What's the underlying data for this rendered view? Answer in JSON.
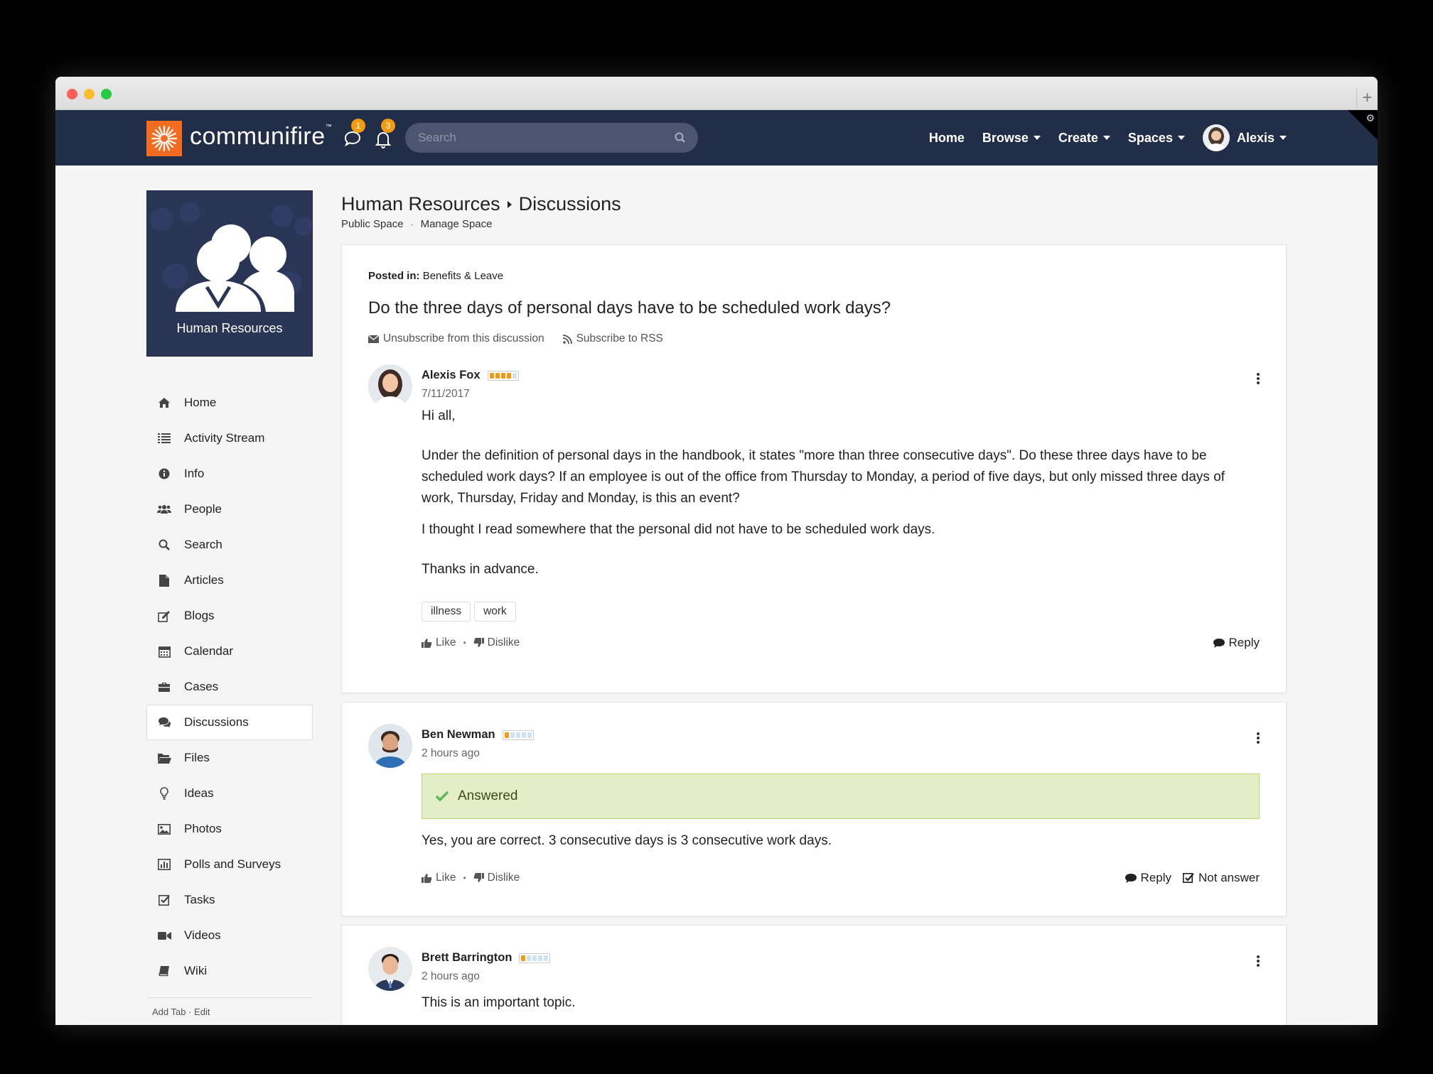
{
  "browser": {
    "new_tab": "+"
  },
  "nav": {
    "logo_text": "communifire",
    "logo_tm": "™",
    "messages_badge": "1",
    "notifications_badge": "3",
    "search_placeholder": "Search",
    "links": {
      "home": "Home",
      "browse": "Browse",
      "create": "Create",
      "spaces": "Spaces"
    },
    "user_name": "Alexis"
  },
  "sidebar": {
    "space_name": "Human Resources",
    "items": [
      {
        "label": "Home",
        "icon": "home-icon"
      },
      {
        "label": "Activity Stream",
        "icon": "list-icon"
      },
      {
        "label": "Info",
        "icon": "info-icon"
      },
      {
        "label": "People",
        "icon": "people-icon"
      },
      {
        "label": "Search",
        "icon": "search-icon"
      },
      {
        "label": "Articles",
        "icon": "document-icon"
      },
      {
        "label": "Blogs",
        "icon": "blog-icon"
      },
      {
        "label": "Calendar",
        "icon": "calendar-icon"
      },
      {
        "label": "Cases",
        "icon": "briefcase-icon"
      },
      {
        "label": "Discussions",
        "icon": "comments-icon",
        "active": true
      },
      {
        "label": "Files",
        "icon": "folder-icon"
      },
      {
        "label": "Ideas",
        "icon": "lightbulb-icon"
      },
      {
        "label": "Photos",
        "icon": "photo-icon"
      },
      {
        "label": "Polls and Surveys",
        "icon": "chart-icon"
      },
      {
        "label": "Tasks",
        "icon": "checkbox-icon"
      },
      {
        "label": "Videos",
        "icon": "video-icon"
      },
      {
        "label": "Wiki",
        "icon": "book-icon"
      }
    ],
    "add_tab": "Add Tab",
    "footer_sep": "·",
    "edit": "Edit"
  },
  "page": {
    "breadcrumb_space": "Human Resources",
    "breadcrumb_page": "Discussions",
    "public_space": "Public Space",
    "subnav_sep": "·",
    "manage_space": "Manage Space"
  },
  "discussion": {
    "posted_in_label": "Posted in:",
    "posted_in_value": "Benefits & Leave",
    "title": "Do the three days of personal days have to be scheduled work days?",
    "unsubscribe": "Unsubscribe from this discussion",
    "subscribe_rss": "Subscribe to RSS"
  },
  "posts": [
    {
      "author": "Alexis Fox",
      "date": "7/11/2017",
      "rank_level": 4,
      "paragraphs": [
        "Hi all,",
        "Under the definition of personal days in the handbook, it states \"more than three consecutive days\". Do these three days have to be scheduled work days? If an employee is out of the office from Thursday to Monday, a period of five days, but only missed three days of work, Thursday, Friday and Monday, is this an event?",
        "I thought I read somewhere that the personal did not have to be scheduled work days.",
        "Thanks in advance."
      ],
      "tags": [
        "illness",
        "work"
      ],
      "like": "Like",
      "sep": "•",
      "dislike": "Dislike",
      "reply": "Reply"
    },
    {
      "author": "Ben Newman",
      "date": "2 hours ago",
      "rank_level": 1,
      "answered": "Answered",
      "text": "Yes, you are correct. 3 consecutive days is 3 consecutive work days.",
      "like": "Like",
      "sep": "•",
      "dislike": "Dislike",
      "reply": "Reply",
      "not_answer": "Not answer"
    },
    {
      "author": "Brett Barrington",
      "date": "2 hours ago",
      "rank_level": 1,
      "text": "This is an important topic."
    }
  ],
  "colors": {
    "navbar": "#222d48",
    "brand_orange": "#f26d21",
    "badge": "#f39c12",
    "answered_bg": "#e4efc8",
    "answered_check": "#5cb85c"
  }
}
